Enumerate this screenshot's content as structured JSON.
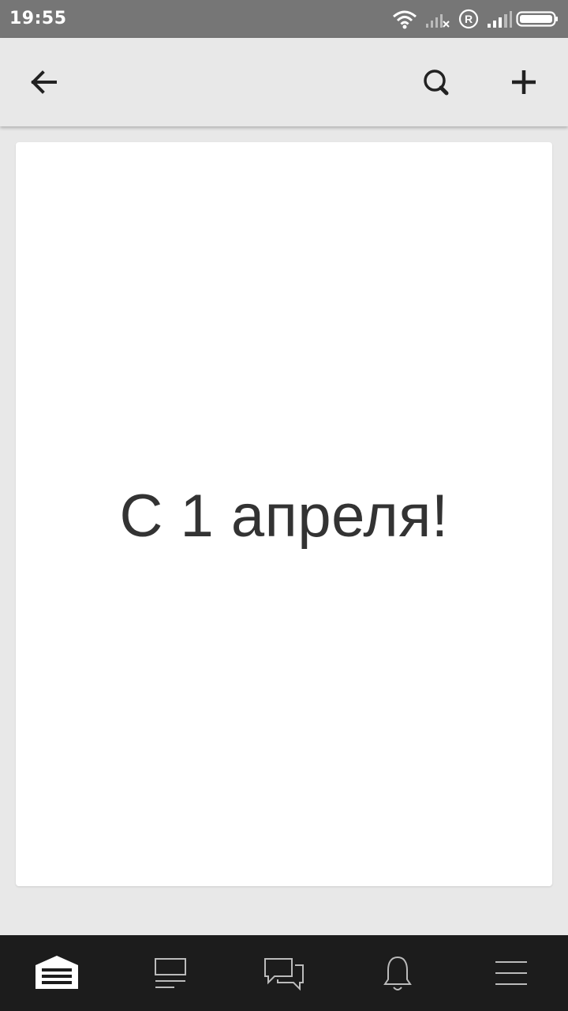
{
  "status_bar": {
    "time": "19:55",
    "icons": [
      "wifi-icon",
      "signal-no-service-icon",
      "roaming-icon",
      "signal-icon",
      "battery-icon"
    ],
    "color": "#767676"
  },
  "app_bar": {
    "icons": [
      "back-arrow-icon",
      "search-icon",
      "plus-icon"
    ]
  },
  "card": {
    "text": "С 1 апреля!"
  },
  "bottom_nav": {
    "items": [
      {
        "icon": "garage-home-icon",
        "active": true
      },
      {
        "icon": "feed-icon",
        "active": false
      },
      {
        "icon": "messages-icon",
        "active": false
      },
      {
        "icon": "bell-icon",
        "active": false
      },
      {
        "icon": "menu-icon",
        "active": false
      }
    ],
    "background": "#1c1c1c"
  }
}
